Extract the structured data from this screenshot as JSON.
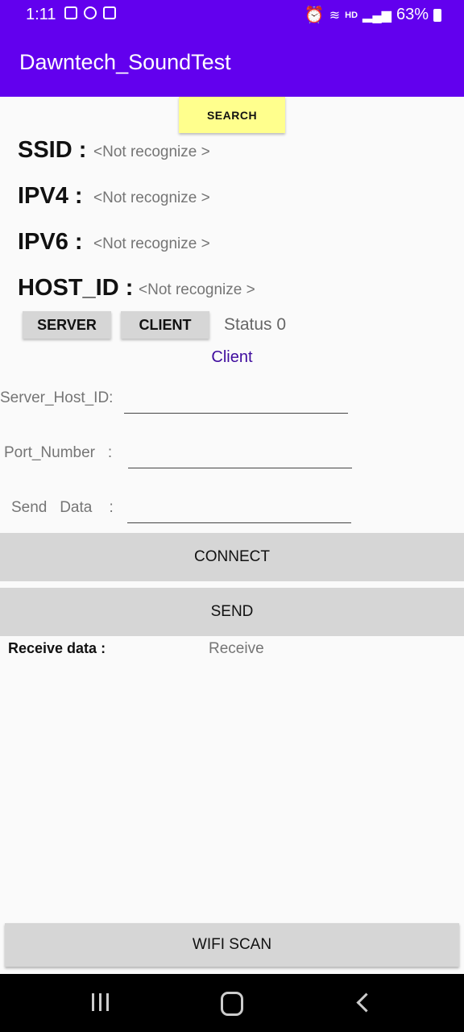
{
  "status_bar": {
    "time": "1:11",
    "hd_label": "HD",
    "battery": "63%"
  },
  "app": {
    "title": "Dawntech_SoundTest"
  },
  "search_label": "SEARCH",
  "info": {
    "ssid_label": "SSID :",
    "ssid_value": "<Not recognize >",
    "ipv4_label": "IPV4 :",
    "ipv4_value": "<Not recognize >",
    "ipv6_label": "IPV6 :",
    "ipv6_value": "<Not recognize >",
    "host_label": "HOST_ID :",
    "host_value": "<Not recognize >"
  },
  "mode": {
    "server_label": "SERVER",
    "client_label": "CLIENT",
    "status_text": "Status  0",
    "current_mode": "Client"
  },
  "form": {
    "server_host_label": "Server_Host_ID:",
    "server_host_value": "",
    "port_label": "Port_Number   :",
    "port_value": "",
    "send_data_label": "Send   Data    :",
    "send_data_value": ""
  },
  "connect_label": "CONNECT",
  "send_label": "SEND",
  "receive": {
    "label": "Receive data  :",
    "value": "Receive"
  },
  "wifi_scan_label": "WIFI SCAN",
  "icons": {
    "status_left": [
      "image-icon",
      "sync-icon",
      "checkbox-icon"
    ],
    "status_right": [
      "alarm-icon",
      "wifi-icon",
      "signal-icon",
      "battery-icon"
    ],
    "nav": [
      "recent-apps-icon",
      "home-icon",
      "back-icon"
    ]
  },
  "colors": {
    "primary": "#6200ee",
    "search_button": "#ffff8d",
    "button_gray": "#d6d6d6",
    "client_text": "#3f0c9e"
  }
}
